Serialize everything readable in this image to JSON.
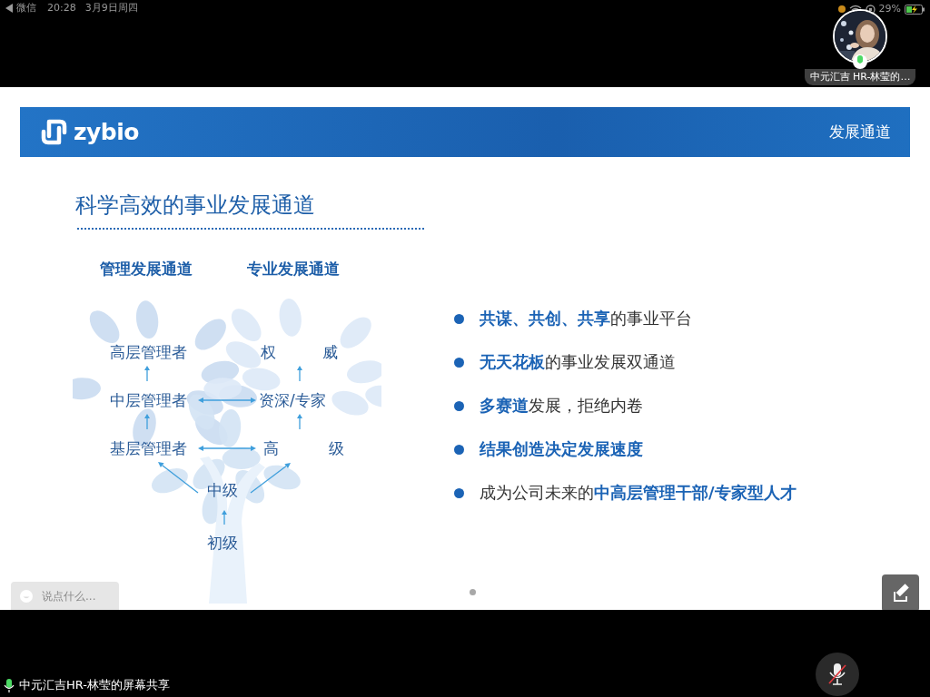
{
  "status_bar": {
    "back_app": "微信",
    "time": "20:28",
    "date": "3月9日周四",
    "battery": "29%",
    "charging": true
  },
  "presenter": {
    "name": "中元汇吉 HR-林莹的…",
    "mic_on": true
  },
  "slide": {
    "logo": "zybio",
    "section": "发展通道",
    "title": "科学高效的事业发展通道",
    "tracks": [
      {
        "label": "管理发展通道"
      },
      {
        "label": "专业发展通道"
      }
    ],
    "nodes": [
      {
        "label": "高层管理者"
      },
      {
        "label": "权 威"
      },
      {
        "label": "中层管理者"
      },
      {
        "label": "资深/专家"
      },
      {
        "label": "基层管理者"
      },
      {
        "label": "高 级"
      },
      {
        "label": "中级"
      },
      {
        "label": "初级"
      }
    ],
    "bullets": [
      {
        "text": "**共谋、共创、共享**的事业平台",
        "emphasis": false
      },
      {
        "text": "**无天花板**的事业发展双通道",
        "emphasis": false
      },
      {
        "text": "**多赛道**发展，拒绝内卷",
        "emphasis": false
      },
      {
        "text": "结果创造决定发展速度",
        "emphasis": true
      },
      {
        "text": "成为公司未来的**中高层管理干部/专家型人才**",
        "emphasis": false
      }
    ]
  },
  "chat": {
    "placeholder": "说点什么..."
  },
  "share_label": "中元汇吉HR-林莹的屏幕共享",
  "mic": {
    "muted": true
  }
}
